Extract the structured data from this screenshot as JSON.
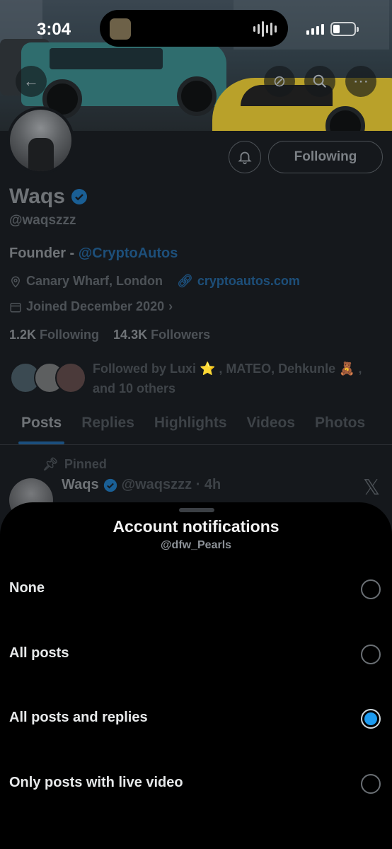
{
  "status_bar": {
    "time": "3:04"
  },
  "profile": {
    "name": "Waqs",
    "handle": "@waqszzz",
    "bio_prefix": "Founder - ",
    "bio_link": "@CryptoAutos",
    "location": "Canary Wharf, London",
    "website": "cryptoautos.com",
    "joined": "Joined December 2020",
    "following_count": "1.2K",
    "following_label": "Following",
    "followers_count": "14.3K",
    "followers_label": "Followers",
    "mutuals_text": "Followed by Luxi ⭐️ , MATEO, Dehkunle 🧸 , and 10 others",
    "follow_button": "Following"
  },
  "tabs": [
    {
      "label": "Posts",
      "active": true
    },
    {
      "label": "Replies"
    },
    {
      "label": "Highlights"
    },
    {
      "label": "Videos"
    },
    {
      "label": "Photos"
    }
  ],
  "pinned_post": {
    "pinned_label": "Pinned",
    "author": "Waqs",
    "handle_time": "@waqszzz · 4h"
  },
  "sheet": {
    "title": "Account notifications",
    "subtitle": "@dfw_Pearls",
    "options": [
      {
        "label": "None",
        "selected": false
      },
      {
        "label": "All posts",
        "selected": false
      },
      {
        "label": "All posts and replies",
        "selected": true
      },
      {
        "label": "Only posts with live video",
        "selected": false
      }
    ]
  },
  "colors": {
    "accent": "#1d9bf0",
    "sheet_bg": "#000000",
    "dimmed_bg": "#15181c"
  }
}
